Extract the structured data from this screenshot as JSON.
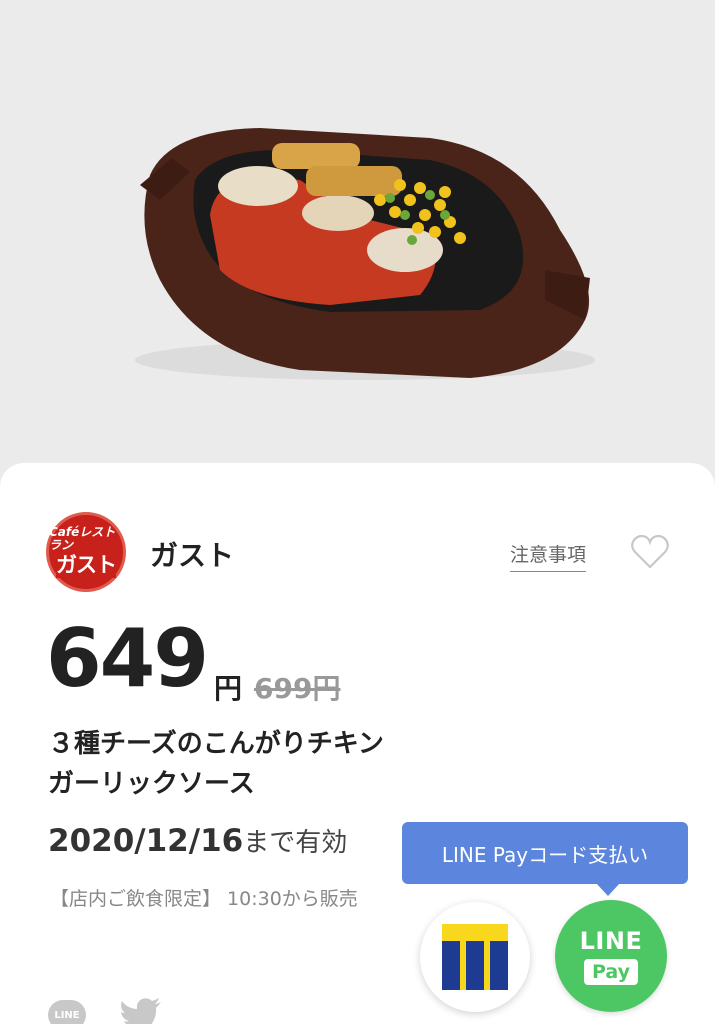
{
  "product_image": {
    "alt": "food-photo"
  },
  "brand": {
    "name": "ガスト",
    "logo_top": "Caféレストラン",
    "logo_main": "ガスト",
    "color": "#c8211b"
  },
  "notes_link": "注意事項",
  "price": {
    "value": "649",
    "unit": "円",
    "original": "699円"
  },
  "title_lines": [
    "３種チーズのこんがりチキン",
    "ガーリックソース"
  ],
  "expiry": {
    "date": "2020/12/16",
    "suffix": "まで有効"
  },
  "note": "【店内ご飲食限定】 10:30から販売",
  "tooltip": "LINE Payコード支払い",
  "payment": {
    "linepay_line": "LINE",
    "linepay_pay": "Pay",
    "linepay_color": "#4cc764",
    "tooltip_color": "#5c85dd"
  },
  "share": {
    "line_label": "LINE"
  }
}
